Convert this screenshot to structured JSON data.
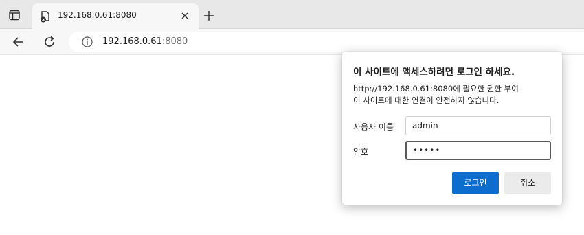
{
  "browser": {
    "tab": {
      "title": "192.168.0.61:8080"
    },
    "address": {
      "host": "192.168.0.61",
      "port": ":8080"
    }
  },
  "dialog": {
    "title": "이 사이트에 액세스하려면 로그인 하세요.",
    "message_line1": "http://192.168.0.61:8080에 필요한 권한 부여",
    "message_line2": "이 사이트에 대한 연결이 안전하지 않습니다.",
    "username_label": "사용자 이름",
    "username_value": "admin",
    "password_label": "암호",
    "password_value": "•••••",
    "login_label": "로그인",
    "cancel_label": "취소"
  },
  "colors": {
    "accent": "#0c6dce",
    "tabstrip": "#e8e8e8",
    "toolbar": "#f7f7f7"
  },
  "icons": [
    "tab-actions-icon",
    "page-error-icon",
    "close-icon",
    "plus-icon",
    "back-arrow-icon",
    "reload-icon",
    "info-icon"
  ]
}
